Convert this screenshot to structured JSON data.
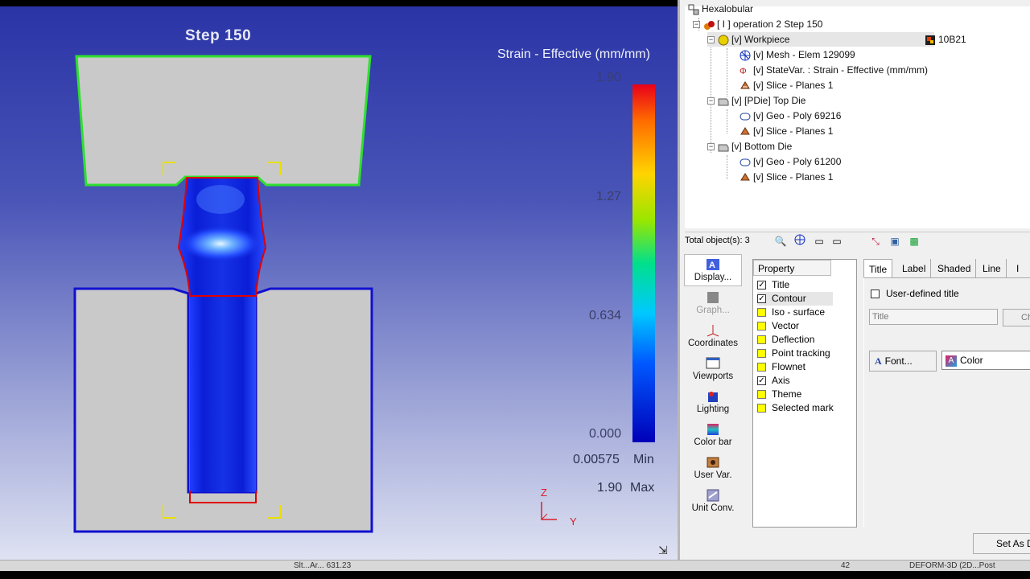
{
  "viewport": {
    "step_title": "Step  150",
    "legend_title": "Strain - Effective (mm/mm)",
    "colorbar_ticks": [
      "1.90",
      "1.27",
      "0.634",
      "0.000"
    ],
    "min_value": "0.00575",
    "min_label": "Min",
    "max_value": "1.90",
    "max_label": "Max",
    "axis_z": "Z",
    "axis_y": "Y",
    "colors": {
      "top_die_outline": "#2ee02e",
      "bottom_die_outline": "#1010d0",
      "workpiece_outline": "#e00000",
      "die_fill": "#c9c9c9",
      "workpiece_fill": "#1a3cf0"
    }
  },
  "statusbar": {
    "left_text": "Slt...Ar...  631.23",
    "mid_text": "42",
    "right_text": "DEFORM-3D (2D...Post"
  },
  "tree": {
    "root": "Hexalobular",
    "operation": "[ I ]  operation 2  Step 150",
    "workpiece": "[v] Workpiece",
    "workpiece_material": "10B21",
    "mesh": "[v] Mesh - Elem 129099",
    "statevar": "[v] StateVar. :  Strain - Effective (mm/mm)",
    "slice1": "[v] Slice - Planes 1",
    "top_die": "[v] [PDie] Top Die",
    "geo_top": "[v] Geo - Poly 69216",
    "slice2": "[v] Slice - Planes 1",
    "bottom_die": "[v] Bottom Die",
    "geo_bottom": "[v] Geo - Poly 61200",
    "slice3": "[v] Slice - Planes 1"
  },
  "objbar": {
    "label": "Total object(s): 3"
  },
  "sidebar": {
    "items": [
      "Display...",
      "Graph...",
      "Coordinates",
      "Viewports",
      "Lighting",
      "Color bar",
      "User Var.",
      "Unit Conv."
    ]
  },
  "property": {
    "header": "Property",
    "rows": [
      {
        "label": "Title",
        "checked": "✓"
      },
      {
        "label": "Contour",
        "checked": "✓"
      },
      {
        "label": "Iso - surface",
        "checked": ""
      },
      {
        "label": "Vector",
        "checked": ""
      },
      {
        "label": "Deflection",
        "checked": ""
      },
      {
        "label": "Point tracking",
        "checked": ""
      },
      {
        "label": "Flownet",
        "checked": ""
      },
      {
        "label": "Axis",
        "checked": "✓"
      },
      {
        "label": "Theme",
        "checked": ""
      },
      {
        "label": "Selected mark",
        "checked": ""
      }
    ]
  },
  "tabs": {
    "items": [
      "Title",
      "Label",
      "Shaded",
      "Line",
      "I"
    ],
    "user_defined_title": "User-defined title",
    "title_placeholder": "Title",
    "change_button": "Cha",
    "font_button": "Font...",
    "color_select": "Color",
    "set_as_default": "Set As D"
  }
}
